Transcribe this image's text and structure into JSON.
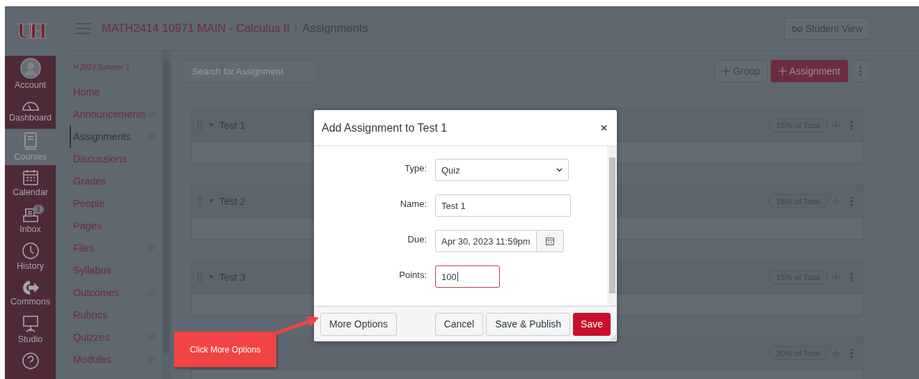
{
  "global_nav": {
    "logo": "UH",
    "items": [
      {
        "label": "Account",
        "selected": false
      },
      {
        "label": "Dashboard",
        "selected": false
      },
      {
        "label": "Courses",
        "selected": true
      },
      {
        "label": "Calendar",
        "selected": false
      },
      {
        "label": "Inbox",
        "selected": false,
        "badge": "3"
      },
      {
        "label": "History",
        "selected": false
      },
      {
        "label": "Commons",
        "selected": false
      },
      {
        "label": "Studio",
        "selected": false
      }
    ]
  },
  "header": {
    "course": "MATH2414 10971 MAIN - Calculus II",
    "page": "Assignments",
    "student_view": "Student View"
  },
  "course_nav": {
    "term": "H 2023 Summer 1",
    "items": [
      {
        "label": "Home",
        "selected": false,
        "hidden": false
      },
      {
        "label": "Announcements",
        "selected": false,
        "hidden": true
      },
      {
        "label": "Assignments",
        "selected": true,
        "hidden": true
      },
      {
        "label": "Discussions",
        "selected": false,
        "hidden": false
      },
      {
        "label": "Grades",
        "selected": false,
        "hidden": false
      },
      {
        "label": "People",
        "selected": false,
        "hidden": false
      },
      {
        "label": "Pages",
        "selected": false,
        "hidden": false
      },
      {
        "label": "Files",
        "selected": false,
        "hidden": true
      },
      {
        "label": "Syllabus",
        "selected": false,
        "hidden": false
      },
      {
        "label": "Outcomes",
        "selected": false,
        "hidden": true
      },
      {
        "label": "Rubrics",
        "selected": false,
        "hidden": false
      },
      {
        "label": "Quizzes",
        "selected": false,
        "hidden": true
      },
      {
        "label": "Modules",
        "selected": false,
        "hidden": true
      }
    ]
  },
  "toolbar": {
    "search": {
      "placeholder": "Search for Assignment"
    },
    "buttons": [
      {
        "label": "Group",
        "primary": false
      },
      {
        "label": "Assignment",
        "primary": true
      }
    ]
  },
  "groups": [
    {
      "name": "Test 1",
      "weight": "15% of Total"
    },
    {
      "name": "Test 2",
      "weight": "15% of Total"
    },
    {
      "name": "Test 3",
      "weight": "15% of Total"
    },
    {
      "weight": "20% of Total"
    }
  ],
  "dialog": {
    "title": "Add Assignment to Test 1",
    "fields": [
      {
        "kind": "select",
        "label": "Type:",
        "value": "Quiz",
        "focused": false
      },
      {
        "kind": "text",
        "label": "Name:",
        "value": "Test 1",
        "focused": false
      },
      {
        "kind": "date",
        "label": "Due:",
        "value": "Apr 30, 2023 11:59pm",
        "focused": false
      },
      {
        "kind": "number",
        "label": "Points:",
        "value": "100",
        "focused": true
      }
    ],
    "more_options": "More Options",
    "buttons": [
      {
        "label": "Cancel",
        "primary": false
      },
      {
        "label": "Save & Publish",
        "primary": false
      },
      {
        "label": "Save",
        "primary": true
      }
    ]
  },
  "callout": {
    "text": "Click More Options"
  }
}
